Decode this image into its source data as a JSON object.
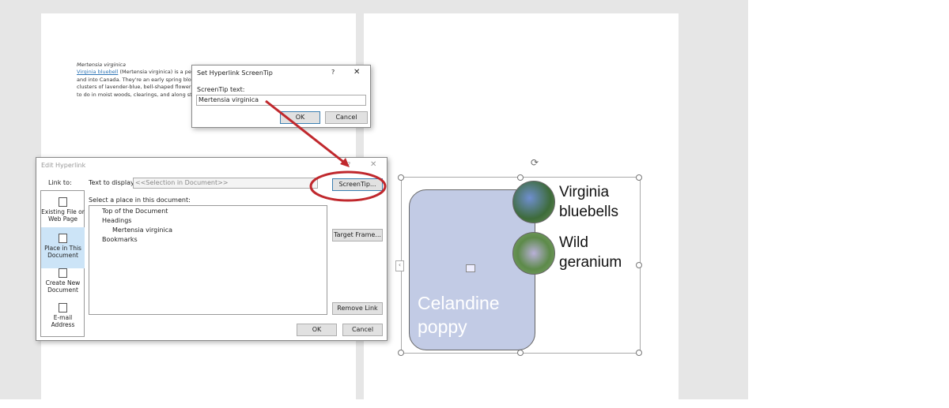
{
  "document": {
    "heading": "Mertensia virginica",
    "lines": [
      {
        "link": "Virginia bluebell",
        "rest": " (Mertensia virginica) is a perenni"
      },
      {
        "rest": "and into Canada. They're an early spring bloomer"
      },
      {
        "rest": "clusters of lavender-blue, bell-shaped flowers. It's"
      },
      {
        "rest": "to do  in moist woods, clearings, and along stream"
      }
    ]
  },
  "screentip_dialog": {
    "title": "Set Hyperlink ScreenTip",
    "help": "?",
    "close": "✕",
    "label": "ScreenTip text:",
    "value": "Mertensia virginica",
    "ok": "OK",
    "cancel": "Cancel"
  },
  "edit_hyperlink": {
    "title": "Edit Hyperlink",
    "help": "?",
    "close": "✕",
    "link_to": "Link to:",
    "nav": [
      {
        "label": "Existing File or Web Page"
      },
      {
        "label": "Place in This Document"
      },
      {
        "label": "Create New Document"
      },
      {
        "label": "E-mail Address"
      }
    ],
    "text_to_display_label": "Text to display:",
    "text_to_display_value": "<<Selection in Document>>",
    "screentip_button": "ScreenTip...",
    "select_place_label": "Select a place in this document:",
    "tree": [
      "Top of the Document",
      "Headings",
      "Mertensia virginica",
      "Bookmarks"
    ],
    "target_frame": "Target Frame...",
    "remove_link": "Remove Link",
    "ok": "OK",
    "cancel": "Cancel"
  },
  "smartart": {
    "main": "Celandine poppy",
    "items": [
      {
        "label": "Virginia bluebells"
      },
      {
        "label": "Wild geranium"
      }
    ],
    "colors": {
      "shape_fill": "#c2cbe5",
      "annotation": "#c0282d"
    }
  }
}
